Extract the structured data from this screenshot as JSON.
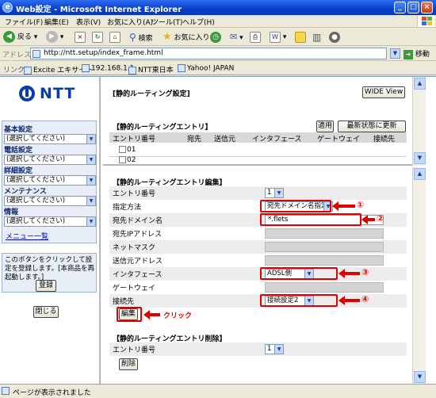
{
  "window": {
    "title": "Web設定 - Microsoft Internet Explorer"
  },
  "menubar": [
    "ファイル(F)",
    "編集(E)",
    "表示(V)",
    "お気に入り(A)",
    "ツール(T)",
    "ヘルプ(H)"
  ],
  "toolbar": {
    "back": "戻る",
    "search": "検索",
    "favorites": "お気に入り"
  },
  "address": {
    "label": "アドレス(D)",
    "url": "http://ntt.setup/index_frame.html",
    "go": "移動"
  },
  "links": {
    "label": "リンク",
    "items": [
      "Excite エキサイト",
      "192.168.1.1",
      "NTT東日本",
      "Yahoo! JAPAN"
    ]
  },
  "logo": "NTT",
  "sidebar": {
    "groups": [
      {
        "label": "基本設定",
        "select": "(選択してください)"
      },
      {
        "label": "電話設定",
        "select": "(選択してください)"
      },
      {
        "label": "詳細設定",
        "select": "(選択してください)"
      },
      {
        "label": "メンテナンス",
        "select": "(選択してください)"
      },
      {
        "label": "情報",
        "select": "(選択してください)"
      }
    ],
    "menu_list": "メニュー一覧",
    "note": "このボタンをクリックして設定を登録します。[本商品を再起動します。]",
    "register": "登録",
    "close": "閉じる"
  },
  "top": {
    "page_title": "[静的ルーティング設定]",
    "wide_view": "WIDE View",
    "entry_title": "【静的ルーティングエントリ】",
    "apply": "適用",
    "refresh": "最新状態に更新",
    "columns": [
      "エントリ番号",
      "宛先",
      "送信元",
      "インタフェース",
      "ゲートウェイ",
      "接続先"
    ],
    "rows": [
      "01",
      "02"
    ]
  },
  "edit": {
    "title": "【静的ルーティングエントリ編集】",
    "fields": [
      {
        "label": "エントリ番号",
        "value": "1"
      },
      {
        "label": "指定方法",
        "value": "宛先ドメイン名指定"
      },
      {
        "label": "宛先ドメイン名",
        "value": "*.flets"
      },
      {
        "label": "宛先IPアドレス",
        "value": ""
      },
      {
        "label": "ネットマスク",
        "value": ""
      },
      {
        "label": "送信元アドレス",
        "value": ""
      },
      {
        "label": "インタフェース",
        "value": "ADSL側"
      },
      {
        "label": "ゲートウェイ",
        "value": ""
      },
      {
        "label": "接続先",
        "value": "接続設定2"
      }
    ],
    "edit_button": "編集",
    "click_note": "クリック",
    "markers": [
      "①",
      "②",
      "③",
      "④"
    ]
  },
  "delete": {
    "title": "【静的ルーティングエントリ削除】",
    "entry_label": "エントリ番号",
    "entry_value": "1",
    "delete_button": "削除"
  },
  "status": {
    "text": "ページが表示されました"
  }
}
